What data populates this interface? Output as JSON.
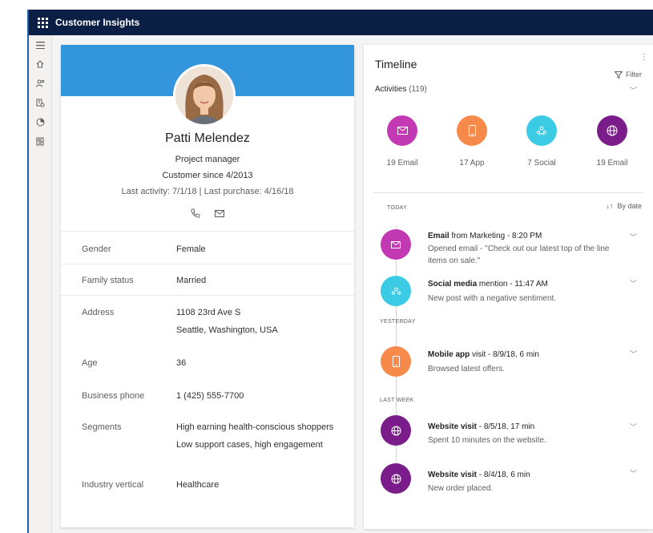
{
  "app": {
    "title": "Customer Insights"
  },
  "nav": [
    "menu-icon",
    "home-icon",
    "contacts-icon",
    "segments-icon",
    "insights-icon",
    "data-icon"
  ],
  "profile": {
    "name": "Patti Melendez",
    "title": "Project manager",
    "customer_since": "Customer since 4/2013",
    "last_activity": "Last activity: 7/1/18  |  Last purchase: 4/16/18",
    "fields": [
      {
        "label": "Gender",
        "values": [
          "Female"
        ]
      },
      {
        "label": "Family status",
        "values": [
          "Married"
        ]
      },
      {
        "label": "Address",
        "values": [
          "1108 23rd Ave S",
          "Seattle, Washington, USA"
        ]
      },
      {
        "label": "Age",
        "values": [
          "36"
        ]
      },
      {
        "label": "Business phone",
        "values": [
          "1 (425) 555-7700"
        ]
      },
      {
        "label": "Segments",
        "values": [
          "High earning health-conscious shoppers",
          "Low support cases, high engagement"
        ]
      },
      {
        "label": "Industry vertical",
        "values": [
          "Healthcare"
        ]
      }
    ]
  },
  "timeline": {
    "title": "Timeline",
    "filter_label": "Filter",
    "activities_label": "Activities",
    "activities_count": "(119)",
    "summary": [
      {
        "label": "19 Email",
        "color": "#c239b3",
        "icon": "email-icon"
      },
      {
        "label": "17 App",
        "color": "#f7894a",
        "icon": "phone-icon"
      },
      {
        "label": "7 Social",
        "color": "#3ccbe4",
        "icon": "social-icon"
      },
      {
        "label": "19 Email",
        "color": "#7a1d8a",
        "icon": "globe-icon"
      }
    ],
    "sort_label": "By date",
    "sections": {
      "today": "TODAY",
      "yesterday": "YESTERDAY",
      "last_week": "LAST WEEK"
    },
    "events": [
      {
        "title_bold": "Email",
        "title_rest": " from Marketing - 8:20 PM",
        "desc": "Opened  email - \"Check out our latest top of the line items on sale.\"",
        "color": "#c239b3",
        "icon": "email-icon"
      },
      {
        "title_bold": "Social media",
        "title_rest": " mention - 11:47 AM",
        "desc": "New post with a negative sentiment.",
        "color": "#3ccbe4",
        "icon": "social-icon"
      },
      {
        "title_bold": "Mobile app",
        "title_rest": " visit - 8/9/18, 6 min",
        "desc": "Browsed latest offers.",
        "color": "#f7894a",
        "icon": "phone-icon"
      },
      {
        "title_bold": "Website visit",
        "title_rest": " - 8/5/18, 17 min",
        "desc": "Spent 10 minutes on the website.",
        "color": "#7a1d8a",
        "icon": "globe-icon"
      },
      {
        "title_bold": "Website visit",
        "title_rest": " - 8/4/18, 6 min",
        "desc": "New order placed.",
        "color": "#7a1d8a",
        "icon": "globe-icon"
      }
    ]
  }
}
